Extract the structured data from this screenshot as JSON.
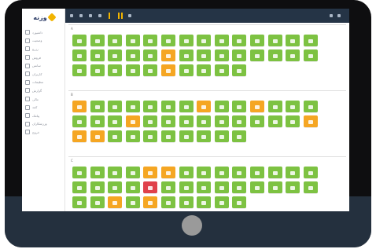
{
  "app": {
    "logo_text": "وزنه"
  },
  "sidebar": {
    "items": [
      {
        "label": "داشبورد",
        "icon": "dashboard-icon"
      },
      {
        "label": "وضعیت",
        "icon": "status-icon"
      },
      {
        "label": "رزرو",
        "icon": "booking-icon"
      },
      {
        "label": "فروش",
        "icon": "sales-icon"
      },
      {
        "label": "سانس",
        "icon": "session-icon"
      },
      {
        "label": "کاربران",
        "icon": "users-icon"
      },
      {
        "label": "تنظیمات",
        "icon": "settings-icon"
      },
      {
        "label": "گزارش",
        "icon": "report-icon"
      },
      {
        "label": "مالی",
        "icon": "finance-icon"
      },
      {
        "label": "کمد",
        "icon": "locker-icon"
      },
      {
        "label": "پیامک",
        "icon": "sms-icon"
      },
      {
        "label": "ورزشکاران",
        "icon": "athletes-icon"
      },
      {
        "label": "خروج",
        "icon": "logout-icon"
      }
    ]
  },
  "topbar": {
    "accent": "#f2b400",
    "background": "#253446"
  },
  "sections": [
    {
      "title": "A",
      "rows": [
        [
          "g",
          "g",
          "g",
          "g",
          "g",
          "g",
          "g",
          "g",
          "g",
          "g",
          "g",
          "g",
          "g",
          "g"
        ],
        [
          "g",
          "g",
          "g",
          "g",
          "g",
          "o",
          "g",
          "g",
          "g",
          "g",
          "g",
          "g",
          "g",
          "g"
        ],
        [
          "g",
          "g",
          "g",
          "g",
          "g",
          "o",
          "g",
          "g",
          "g",
          "g"
        ]
      ]
    },
    {
      "title": "B",
      "rows": [
        [
          "o",
          "g",
          "g",
          "g",
          "g",
          "g",
          "g",
          "o",
          "g",
          "g",
          "o",
          "g",
          "g",
          "g"
        ],
        [
          "g",
          "g",
          "g",
          "o",
          "g",
          "g",
          "g",
          "g",
          "g",
          "g",
          "g",
          "g",
          "g",
          "o"
        ],
        [
          "o",
          "o",
          "g",
          "g",
          "g",
          "g",
          "g",
          "g",
          "g",
          "g"
        ]
      ]
    },
    {
      "title": "C",
      "rows": [
        [
          "g",
          "g",
          "g",
          "g",
          "o",
          "o",
          "g",
          "g",
          "g",
          "g",
          "g",
          "g",
          "g",
          "g"
        ],
        [
          "g",
          "g",
          "g",
          "g",
          "r",
          "g",
          "g",
          "g",
          "g",
          "g",
          "g",
          "g",
          "g",
          "g"
        ],
        [
          "g",
          "g",
          "o",
          "g",
          "o",
          "g",
          "g",
          "g",
          "g",
          "g"
        ]
      ]
    }
  ],
  "colors": {
    "available": "#7dc242",
    "reserved": "#f5a623",
    "blocked": "#e0414b"
  }
}
